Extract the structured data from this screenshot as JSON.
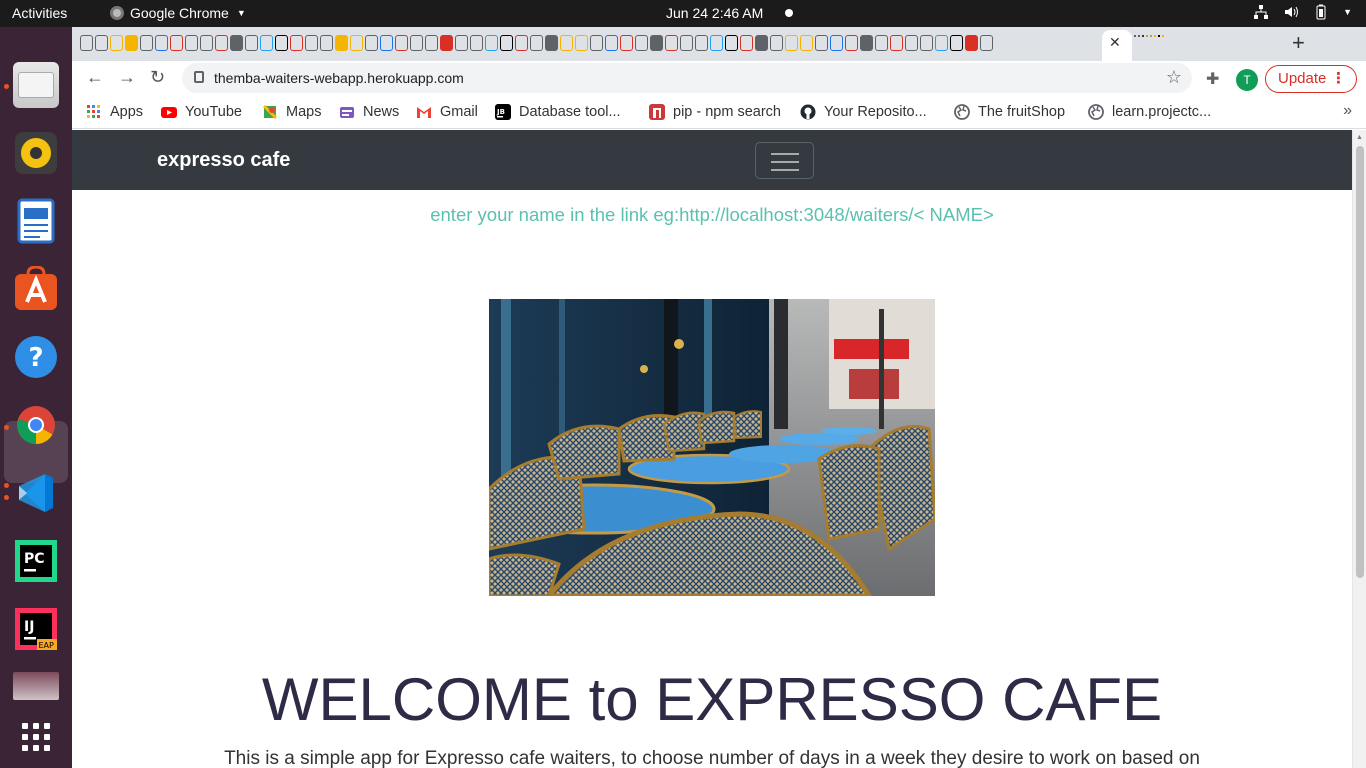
{
  "topbar": {
    "activities": "Activities",
    "app_name": "Google Chrome",
    "clock": "Jun 24  2:46 AM"
  },
  "dock": {
    "items": [
      "files-icon",
      "rhythmbox-icon",
      "writer-icon",
      "software-icon",
      "help-icon",
      "chrome-icon",
      "vscode-icon",
      "pycharm-icon",
      "intellij-icon",
      "screenshot-icon",
      "app-grid-icon"
    ]
  },
  "browser": {
    "url": "themba-waiters-webapp.herokuapp.com",
    "profile_initial": "T",
    "update_label": "Update",
    "bookmarks": [
      {
        "label": "Apps"
      },
      {
        "label": "YouTube"
      },
      {
        "label": "Maps"
      },
      {
        "label": "News"
      },
      {
        "label": "Gmail"
      },
      {
        "label": "Database tool..."
      },
      {
        "label": "pip - npm search"
      },
      {
        "label": "Your Reposito..."
      },
      {
        "label": "The fruitShop"
      },
      {
        "label": "learn.projectc..."
      }
    ]
  },
  "page": {
    "brand": "expresso cafe",
    "hint": "enter your name in the link eg:http://localhost:3048/waiters/< NAME>",
    "welcome": "WELCOME to EXPRESSO CAFE",
    "description": "This is a simple app for Expresso cafe waiters, to choose number of days in a week they desire to work on based on"
  },
  "colors": {
    "navbar": "#343a40",
    "hint": "#5bc0b0",
    "update": "#d93025"
  }
}
